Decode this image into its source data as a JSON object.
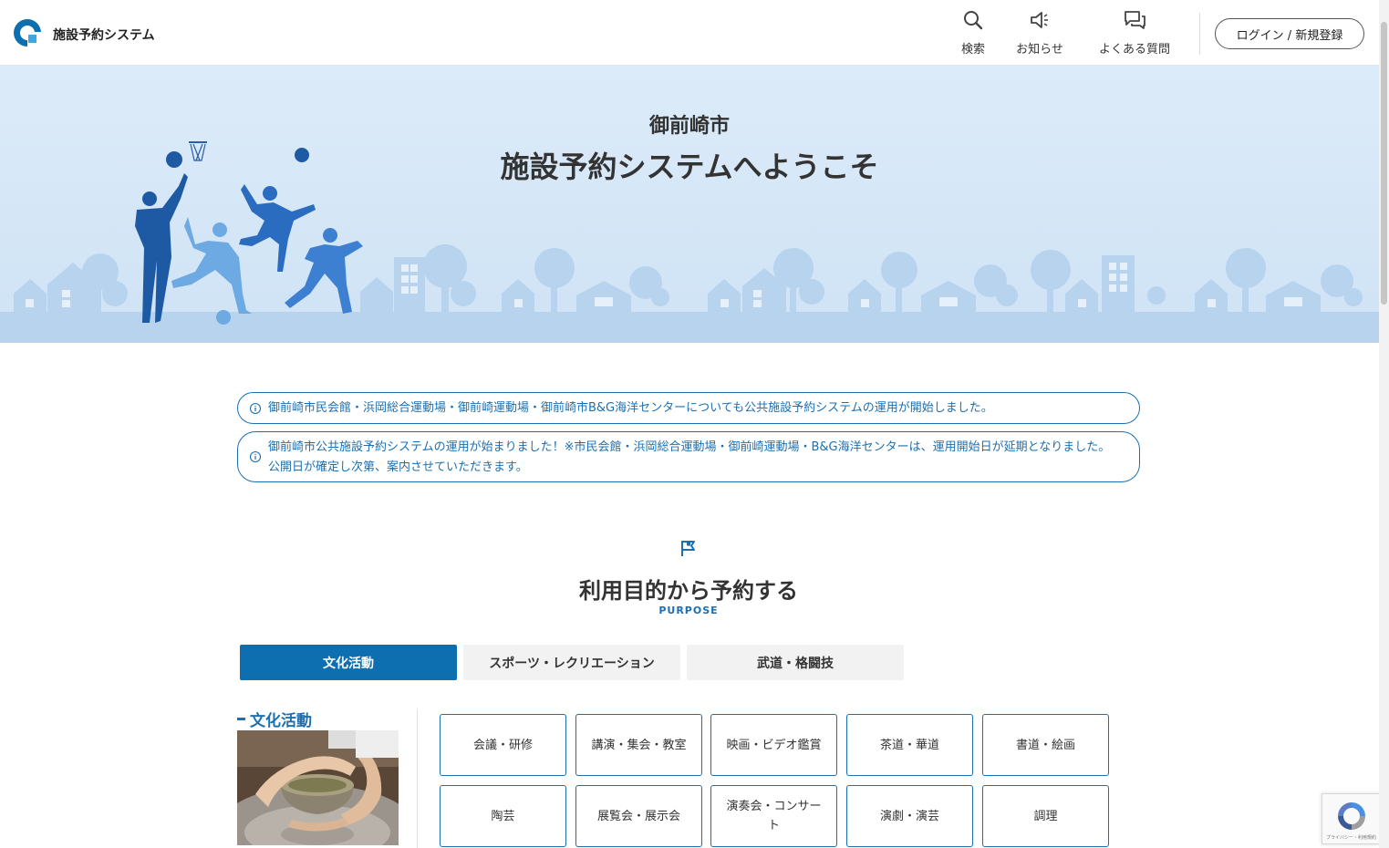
{
  "header": {
    "brand": "施設予約システム",
    "nav": [
      {
        "label": "検索",
        "icon": "search-icon"
      },
      {
        "label": "お知らせ",
        "icon": "megaphone-icon"
      },
      {
        "label": "よくある質問",
        "icon": "chat-icon"
      }
    ],
    "login_label": "ログイン / 新規登録"
  },
  "hero": {
    "subtitle": "御前崎市",
    "title": "施設予約システムへようこそ"
  },
  "notices": [
    "御前崎市民会館・浜岡総合運動場・御前崎運動場・御前崎市B&G海洋センターについても公共施設予約システムの運用が開始しました。",
    "御前崎市公共施設予約システムの運用が始まりました！※市民会館・浜岡総合運動場・御前崎運動場・B&G海洋センターは、運用開始日が延期となりました。公開日が確定し次第、案内させていただきます。"
  ],
  "purpose": {
    "title": "利用目的から予約する",
    "title_en": "PURPOSE",
    "tabs": [
      "文化活動",
      "スポーツ・レクリエーション",
      "武道・格闘技"
    ],
    "active_tab": 0,
    "category": {
      "heading": "文化活動",
      "items": [
        "会議・研修",
        "講演・集会・教室",
        "映画・ビデオ鑑賞",
        "茶道・華道",
        "書道・絵画",
        "陶芸",
        "展覧会・展示会",
        "演奏会・コンサート",
        "演劇・演芸",
        "調理"
      ]
    }
  },
  "recaptcha": {
    "footer": "プライバシー・利用規約"
  },
  "colors": {
    "primary": "#0d6fb0",
    "notice": "#1c6fb0",
    "hero_bg": "#dcebf9"
  }
}
